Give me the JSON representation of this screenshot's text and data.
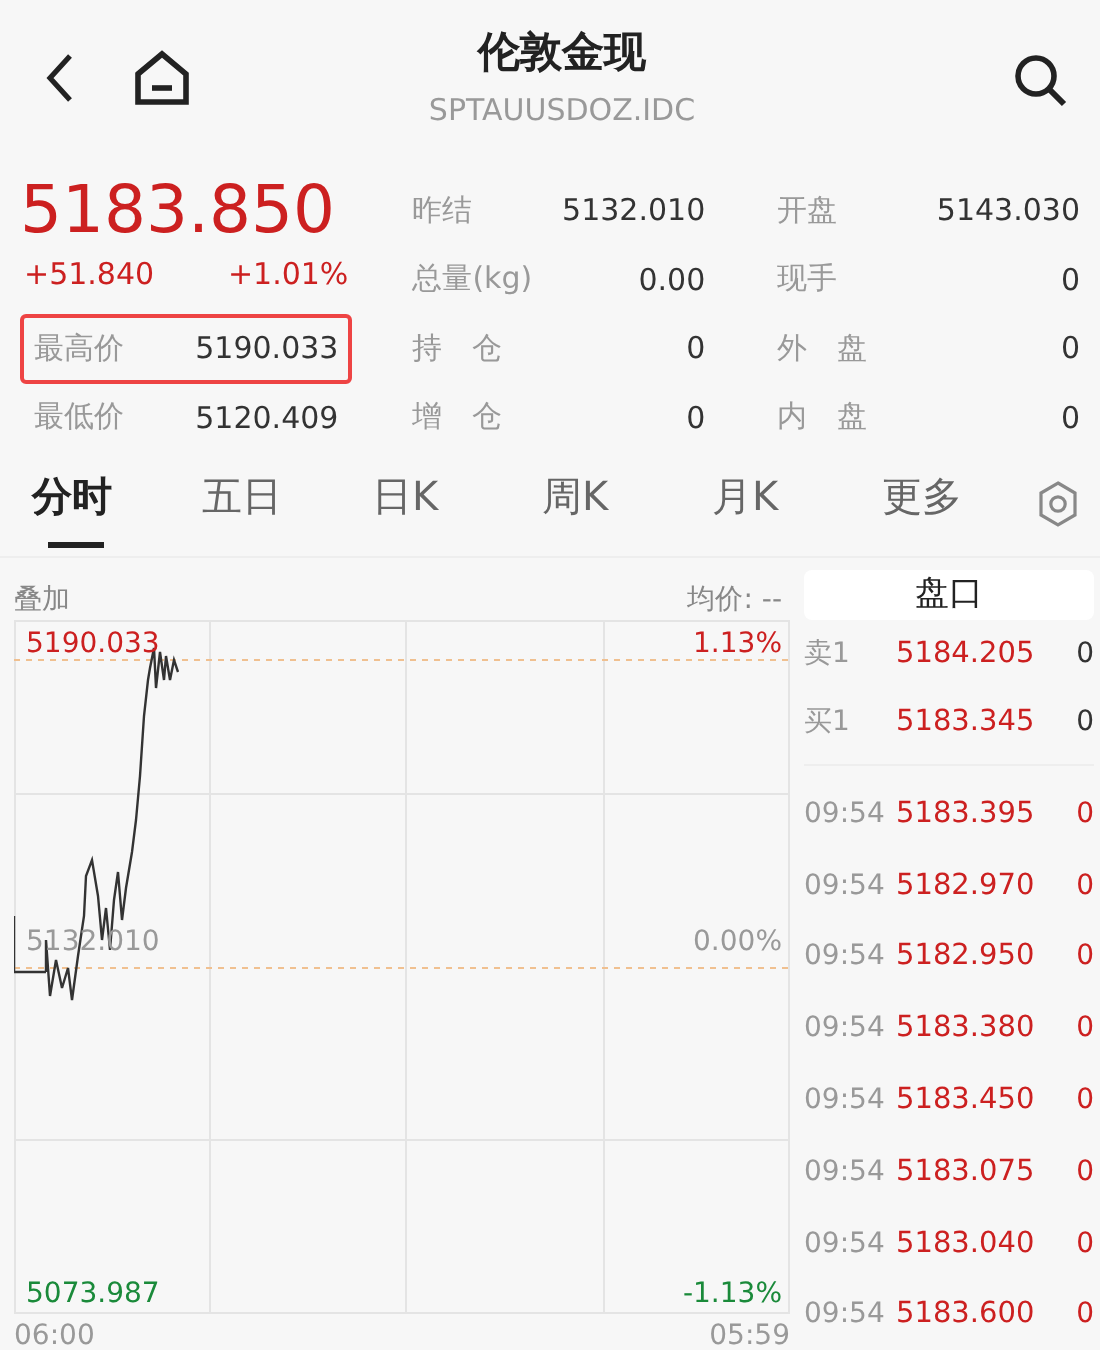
{
  "header": {
    "title": "伦敦金现",
    "subtitle": "SPTAUUSDOZ.IDC"
  },
  "quote": {
    "price": "5183.850",
    "change": "+51.840",
    "change_pct": "+1.01%"
  },
  "left_stats": [
    {
      "label": "最高价",
      "value": "5190.033",
      "highlighted": true
    },
    {
      "label": "最低价",
      "value": "5120.409",
      "highlighted": false
    }
  ],
  "mid_stats": [
    {
      "label": "昨结",
      "value": "5132.010"
    },
    {
      "label": "总量(kg)",
      "value": "0.00"
    },
    {
      "label": "持　仓",
      "value": "0"
    },
    {
      "label": "增　仓",
      "value": "0"
    }
  ],
  "right_stats": [
    {
      "label": "开盘",
      "value": "5143.030"
    },
    {
      "label": "现手",
      "value": "0"
    },
    {
      "label": "外　盘",
      "value": "0"
    },
    {
      "label": "内　盘",
      "value": "0"
    }
  ],
  "tabs": [
    {
      "label": "分时",
      "selected": true
    },
    {
      "label": "五日",
      "selected": false
    },
    {
      "label": "日K",
      "selected": false
    },
    {
      "label": "周K",
      "selected": false
    },
    {
      "label": "月K",
      "selected": false
    },
    {
      "label": "更多",
      "selected": false
    }
  ],
  "chart": {
    "overlay_label": "叠加",
    "avg_label": "均价: --",
    "high_price": "5190.033",
    "high_pct": "1.13%",
    "base_price": "5132.010",
    "base_pct": "0.00%",
    "low_price": "5073.987",
    "low_pct": "-1.13%",
    "time_start": "06:00",
    "time_end": "05:59"
  },
  "order_book": {
    "title": "盘口",
    "quotes": [
      {
        "label": "卖1",
        "price": "5184.205",
        "volume": "0"
      },
      {
        "label": "买1",
        "price": "5183.345",
        "volume": "0"
      }
    ],
    "trades": [
      {
        "time": "09:54",
        "price": "5183.395",
        "volume": "0"
      },
      {
        "time": "09:54",
        "price": "5182.970",
        "volume": "0"
      },
      {
        "time": "09:54",
        "price": "5182.950",
        "volume": "0"
      },
      {
        "time": "09:54",
        "price": "5183.380",
        "volume": "0"
      },
      {
        "time": "09:54",
        "price": "5183.450",
        "volume": "0"
      },
      {
        "time": "09:54",
        "price": "5183.075",
        "volume": "0"
      },
      {
        "time": "09:54",
        "price": "5183.040",
        "volume": "0"
      },
      {
        "time": "09:54",
        "price": "5183.600",
        "volume": "0"
      }
    ]
  }
}
